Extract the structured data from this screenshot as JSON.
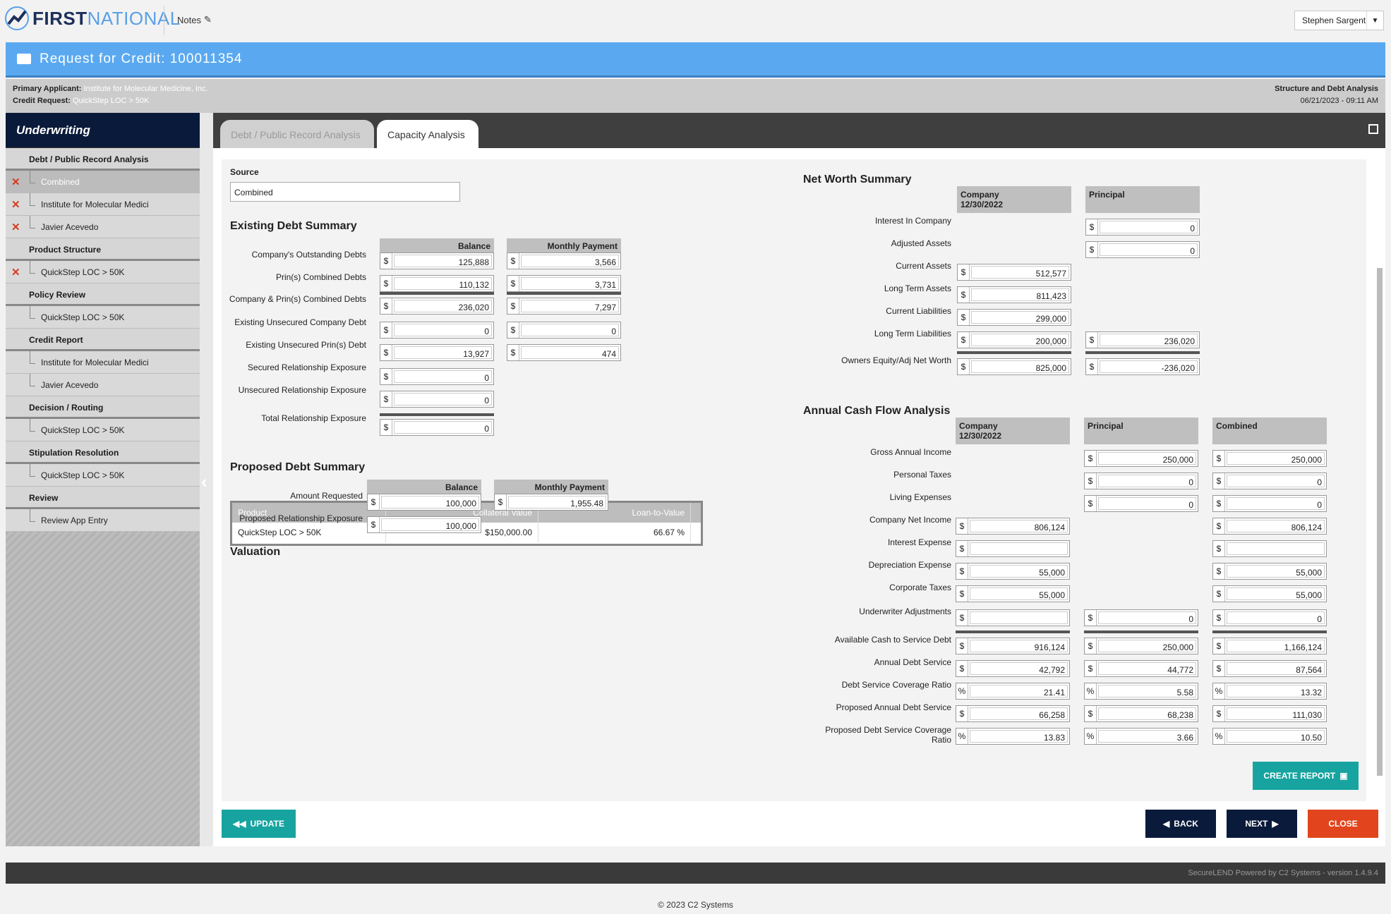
{
  "app": {
    "logo_first": "FIRST",
    "logo_second": "NATIONAL",
    "notes": "Notes",
    "user": "Stephen Sargent"
  },
  "request": {
    "title": "Request for Credit: 100011354",
    "primary_label": "Primary Applicant:",
    "primary_value": "Institute for Molecular Medicine, Inc.",
    "credit_label": "Credit Request:",
    "credit_value": "QuickStep LOC > 50K",
    "right_title": "Structure and Debt Analysis",
    "right_date": "06/21/2023 - 09:11 AM"
  },
  "sidebar": {
    "title": "Underwriting",
    "sections": [
      {
        "label": "Debt / Public Record Analysis",
        "items": [
          {
            "label": "Combined",
            "x": true,
            "sel": true
          },
          {
            "label": "Institute for Molecular Medici",
            "x": true
          },
          {
            "label": "Javier Acevedo",
            "x": true
          }
        ]
      },
      {
        "label": "Product Structure",
        "items": [
          {
            "label": "QuickStep LOC > 50K",
            "x": true
          }
        ]
      },
      {
        "label": "Policy Review",
        "items": [
          {
            "label": "QuickStep LOC > 50K"
          }
        ]
      },
      {
        "label": "Credit Report",
        "items": [
          {
            "label": "Institute for Molecular Medici"
          },
          {
            "label": "Javier Acevedo"
          }
        ]
      },
      {
        "label": "Decision / Routing",
        "items": [
          {
            "label": "QuickStep LOC > 50K"
          }
        ]
      },
      {
        "label": "Stipulation Resolution",
        "items": [
          {
            "label": "QuickStep LOC > 50K"
          }
        ]
      },
      {
        "label": "Review",
        "items": [
          {
            "label": "Review App Entry"
          }
        ]
      }
    ]
  },
  "tabs": {
    "tab1": "Debt / Public Record Analysis",
    "tab2": "Capacity Analysis"
  },
  "source": {
    "label": "Source",
    "value": "Combined"
  },
  "existing": {
    "title": "Existing Debt Summary",
    "col_balance": "Balance",
    "col_payment": "Monthly Payment",
    "rows": [
      {
        "label": "Company's Outstanding Debts",
        "balance": "125,888",
        "payment": "3,566"
      },
      {
        "label": "Prin(s) Combined Debts",
        "balance": "110,132",
        "payment": "3,731"
      },
      {
        "label": "Company & Prin(s) Combined Debts",
        "balance": "236,020",
        "payment": "7,297"
      },
      {
        "label": "Existing Unsecured Company Debt",
        "balance": "0",
        "payment": "0"
      },
      {
        "label": "Existing Unsecured Prin(s) Debt",
        "balance": "13,927",
        "payment": "474"
      },
      {
        "label": "Secured Relationship Exposure",
        "balance": "0"
      },
      {
        "label": "Unsecured Relationship Exposure",
        "balance": "0"
      },
      {
        "label": "Total Relationship Exposure",
        "balance": "0"
      }
    ]
  },
  "proposed": {
    "title": "Proposed Debt Summary",
    "col_balance": "Balance",
    "col_payment": "Monthly Payment",
    "amount_label": "Amount Requested",
    "amount_balance": "100,000",
    "amount_payment": "1,955.48",
    "exposure_label": "Proposed Relationship Exposure",
    "exposure_balance": "100,000"
  },
  "valuation": {
    "title": "Valuation",
    "headers": [
      "Product",
      "Collateral Value",
      "Loan-to-Value"
    ],
    "row": [
      "QuickStep LOC > 50K",
      "$150,000.00",
      "66.67 %"
    ]
  },
  "networth": {
    "title": "Net Worth Summary",
    "col_company": "Company",
    "col_company_date": "12/30/2022",
    "col_principal": "Principal",
    "rows": [
      {
        "label": "Interest In Company",
        "principal": "0"
      },
      {
        "label": "Adjusted Assets",
        "principal": "0"
      },
      {
        "label": "Current Assets",
        "company": "512,577"
      },
      {
        "label": "Long Term Assets",
        "company": "811,423"
      },
      {
        "label": "Current Liabilities",
        "company": "299,000"
      },
      {
        "label": "Long Term Liabilities",
        "company": "200,000",
        "principal": "236,020"
      },
      {
        "label": "Owners Equity/Adj Net Worth",
        "company": "825,000",
        "principal": "-236,020"
      }
    ]
  },
  "cashflow": {
    "title": "Annual Cash Flow Analysis",
    "col_company": "Company",
    "col_company_date": "12/30/2022",
    "col_principal": "Principal",
    "col_combined": "Combined",
    "rows": [
      {
        "label": "Gross Annual Income",
        "principal": "250,000",
        "combined": "250,000"
      },
      {
        "label": "Personal Taxes",
        "principal": "0",
        "combined": "0"
      },
      {
        "label": "Living Expenses",
        "principal": "0",
        "combined": "0"
      },
      {
        "label": "Company Net Income",
        "company": "806,124",
        "combined": "806,124"
      },
      {
        "label": "Interest Expense",
        "company": "",
        "combined": ""
      },
      {
        "label": "Depreciation Expense",
        "company": "55,000",
        "combined": "55,000"
      },
      {
        "label": "Corporate Taxes",
        "company": "55,000",
        "combined": "55,000"
      },
      {
        "label": "Underwriter Adjustments",
        "company": "",
        "principal": "0",
        "combined": "0"
      },
      {
        "label": "Available Cash to Service Debt",
        "company": "916,124",
        "principal": "250,000",
        "combined": "1,166,124"
      },
      {
        "label": "Annual Debt Service",
        "company": "42,792",
        "principal": "44,772",
        "combined": "87,564"
      },
      {
        "label": "Debt Service Coverage Ratio",
        "company": "21.41",
        "principal": "5.58",
        "combined": "13.32",
        "unit": "%"
      },
      {
        "label": "Proposed Annual Debt Service",
        "company": "66,258",
        "principal": "68,238",
        "combined": "111,030"
      },
      {
        "label": "Proposed Debt Service Coverage Ratio",
        "company": "13.83",
        "principal": "3.66",
        "combined": "10.50",
        "unit": "%"
      }
    ]
  },
  "buttons": {
    "create_report": "CREATE REPORT",
    "update": "UPDATE",
    "back": "BACK",
    "next": "NEXT",
    "close": "CLOSE"
  },
  "footer": {
    "powered": "SecureLEND Powered by C2 Systems - version 1.4.9.4",
    "copyright": "© 2023 C2 Systems"
  },
  "colors": {
    "blue": "#5aa9f0",
    "navy": "#0a1a3a",
    "teal": "#17a4a0",
    "red": "#e2451d"
  }
}
